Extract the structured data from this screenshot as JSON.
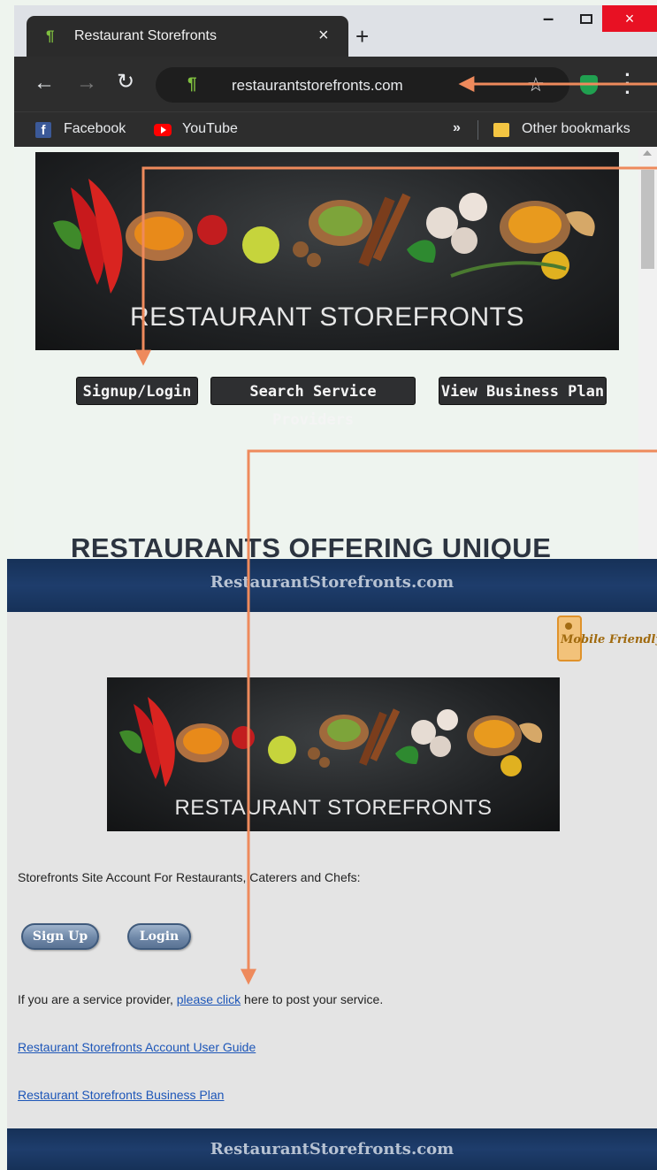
{
  "browser": {
    "tab_title": "Restaurant Storefronts",
    "tab_close": "×",
    "new_tab": "+",
    "window_min": "–",
    "window_close": "×",
    "url": "restaurantstorefronts.com",
    "bookmarks": [
      {
        "label": "Facebook",
        "icon": "facebook-icon"
      },
      {
        "label": "YouTube",
        "icon": "youtube-icon"
      }
    ],
    "bookmarks_overflow": "»",
    "other_bookmarks": "Other bookmarks"
  },
  "new_site": {
    "banner_text": "RESTAURANT STOREFRONTS",
    "buttons": {
      "signup_login": "Signup/Login",
      "search_providers": "Search Service Providers",
      "business_plan": "View Business Plan"
    },
    "headline": "RESTAURANTS OFFERING UNIQUE"
  },
  "old_site": {
    "header_title": "RestaurantStorefronts.com",
    "mobile_badge": "Mobile Friendly",
    "banner_text": "RESTAURANT STOREFRONTS",
    "account_label": "Storefronts Site Account For Restaurants, Caterers and Chefs:",
    "signup_button": "Sign Up",
    "login_button": "Login",
    "provider_prefix": "If you are a service provider,",
    "provider_link": "please click",
    "provider_suffix": "here to post your service.",
    "guide_link": "Restaurant Storefronts Account User Guide",
    "plan_link": "Restaurant Storefronts Business Plan",
    "footer_title": "RestaurantStorefronts.com"
  },
  "colors": {
    "annotation_arrow": "#ee8a5c",
    "browser_dark": "#2d2d2d",
    "old_header_navy": "#1a3663",
    "link_blue": "#1d56b8"
  }
}
